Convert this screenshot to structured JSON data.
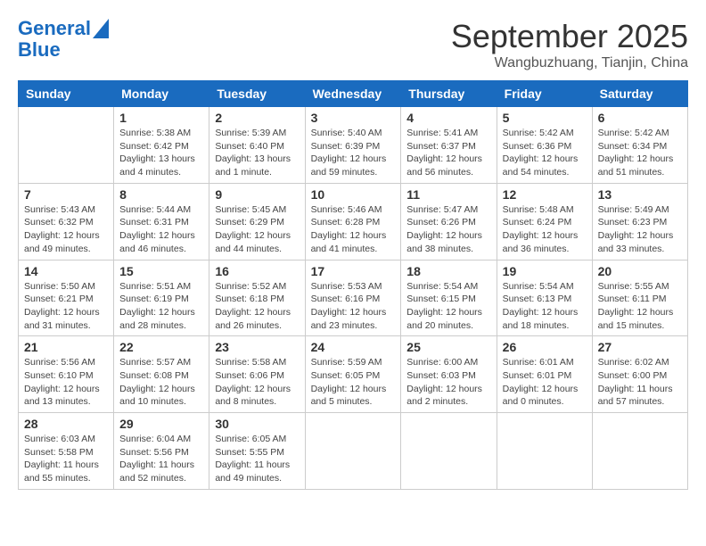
{
  "header": {
    "logo_line1": "General",
    "logo_line2": "Blue",
    "month": "September 2025",
    "location": "Wangbuzhuang, Tianjin, China"
  },
  "days_of_week": [
    "Sunday",
    "Monday",
    "Tuesday",
    "Wednesday",
    "Thursday",
    "Friday",
    "Saturday"
  ],
  "weeks": [
    [
      {
        "day": "",
        "info": ""
      },
      {
        "day": "1",
        "info": "Sunrise: 5:38 AM\nSunset: 6:42 PM\nDaylight: 13 hours\nand 4 minutes."
      },
      {
        "day": "2",
        "info": "Sunrise: 5:39 AM\nSunset: 6:40 PM\nDaylight: 13 hours\nand 1 minute."
      },
      {
        "day": "3",
        "info": "Sunrise: 5:40 AM\nSunset: 6:39 PM\nDaylight: 12 hours\nand 59 minutes."
      },
      {
        "day": "4",
        "info": "Sunrise: 5:41 AM\nSunset: 6:37 PM\nDaylight: 12 hours\nand 56 minutes."
      },
      {
        "day": "5",
        "info": "Sunrise: 5:42 AM\nSunset: 6:36 PM\nDaylight: 12 hours\nand 54 minutes."
      },
      {
        "day": "6",
        "info": "Sunrise: 5:42 AM\nSunset: 6:34 PM\nDaylight: 12 hours\nand 51 minutes."
      }
    ],
    [
      {
        "day": "7",
        "info": "Sunrise: 5:43 AM\nSunset: 6:32 PM\nDaylight: 12 hours\nand 49 minutes."
      },
      {
        "day": "8",
        "info": "Sunrise: 5:44 AM\nSunset: 6:31 PM\nDaylight: 12 hours\nand 46 minutes."
      },
      {
        "day": "9",
        "info": "Sunrise: 5:45 AM\nSunset: 6:29 PM\nDaylight: 12 hours\nand 44 minutes."
      },
      {
        "day": "10",
        "info": "Sunrise: 5:46 AM\nSunset: 6:28 PM\nDaylight: 12 hours\nand 41 minutes."
      },
      {
        "day": "11",
        "info": "Sunrise: 5:47 AM\nSunset: 6:26 PM\nDaylight: 12 hours\nand 38 minutes."
      },
      {
        "day": "12",
        "info": "Sunrise: 5:48 AM\nSunset: 6:24 PM\nDaylight: 12 hours\nand 36 minutes."
      },
      {
        "day": "13",
        "info": "Sunrise: 5:49 AM\nSunset: 6:23 PM\nDaylight: 12 hours\nand 33 minutes."
      }
    ],
    [
      {
        "day": "14",
        "info": "Sunrise: 5:50 AM\nSunset: 6:21 PM\nDaylight: 12 hours\nand 31 minutes."
      },
      {
        "day": "15",
        "info": "Sunrise: 5:51 AM\nSunset: 6:19 PM\nDaylight: 12 hours\nand 28 minutes."
      },
      {
        "day": "16",
        "info": "Sunrise: 5:52 AM\nSunset: 6:18 PM\nDaylight: 12 hours\nand 26 minutes."
      },
      {
        "day": "17",
        "info": "Sunrise: 5:53 AM\nSunset: 6:16 PM\nDaylight: 12 hours\nand 23 minutes."
      },
      {
        "day": "18",
        "info": "Sunrise: 5:54 AM\nSunset: 6:15 PM\nDaylight: 12 hours\nand 20 minutes."
      },
      {
        "day": "19",
        "info": "Sunrise: 5:54 AM\nSunset: 6:13 PM\nDaylight: 12 hours\nand 18 minutes."
      },
      {
        "day": "20",
        "info": "Sunrise: 5:55 AM\nSunset: 6:11 PM\nDaylight: 12 hours\nand 15 minutes."
      }
    ],
    [
      {
        "day": "21",
        "info": "Sunrise: 5:56 AM\nSunset: 6:10 PM\nDaylight: 12 hours\nand 13 minutes."
      },
      {
        "day": "22",
        "info": "Sunrise: 5:57 AM\nSunset: 6:08 PM\nDaylight: 12 hours\nand 10 minutes."
      },
      {
        "day": "23",
        "info": "Sunrise: 5:58 AM\nSunset: 6:06 PM\nDaylight: 12 hours\nand 8 minutes."
      },
      {
        "day": "24",
        "info": "Sunrise: 5:59 AM\nSunset: 6:05 PM\nDaylight: 12 hours\nand 5 minutes."
      },
      {
        "day": "25",
        "info": "Sunrise: 6:00 AM\nSunset: 6:03 PM\nDaylight: 12 hours\nand 2 minutes."
      },
      {
        "day": "26",
        "info": "Sunrise: 6:01 AM\nSunset: 6:01 PM\nDaylight: 12 hours\nand 0 minutes."
      },
      {
        "day": "27",
        "info": "Sunrise: 6:02 AM\nSunset: 6:00 PM\nDaylight: 11 hours\nand 57 minutes."
      }
    ],
    [
      {
        "day": "28",
        "info": "Sunrise: 6:03 AM\nSunset: 5:58 PM\nDaylight: 11 hours\nand 55 minutes."
      },
      {
        "day": "29",
        "info": "Sunrise: 6:04 AM\nSunset: 5:56 PM\nDaylight: 11 hours\nand 52 minutes."
      },
      {
        "day": "30",
        "info": "Sunrise: 6:05 AM\nSunset: 5:55 PM\nDaylight: 11 hours\nand 49 minutes."
      },
      {
        "day": "",
        "info": ""
      },
      {
        "day": "",
        "info": ""
      },
      {
        "day": "",
        "info": ""
      },
      {
        "day": "",
        "info": ""
      }
    ]
  ]
}
